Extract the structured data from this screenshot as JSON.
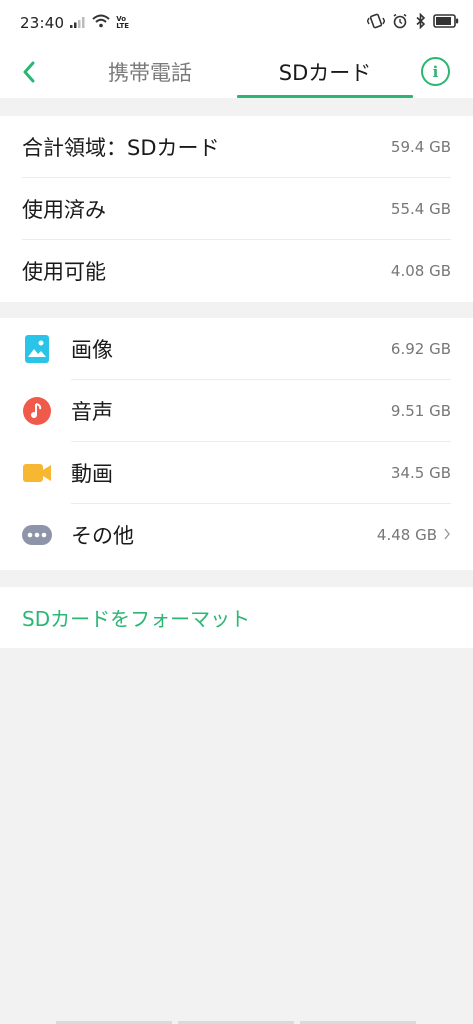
{
  "status_bar": {
    "time": "23:40",
    "volte_top": "Vo",
    "volte_bottom": "LTE",
    "icons": [
      "signal-icon",
      "wifi-icon",
      "volte-icon",
      "vibrate-icon",
      "alarm-icon",
      "bluetooth-icon",
      "battery-icon"
    ]
  },
  "header": {
    "tabs": [
      {
        "label": "携帯電話",
        "active": false
      },
      {
        "label": "SDカード",
        "active": true
      }
    ],
    "info_label": "i",
    "accent_color": "#2bb673"
  },
  "summary": {
    "rows": [
      {
        "label": "合計領域：SDカード",
        "value": "59.4 GB"
      },
      {
        "label": "使用済み",
        "value": "55.4 GB"
      },
      {
        "label": "使用可能",
        "value": "4.08 GB"
      }
    ]
  },
  "categories": {
    "rows": [
      {
        "label": "画像",
        "value": "6.92 GB",
        "icon": "image-icon",
        "color": "#29c4e8"
      },
      {
        "label": "音声",
        "value": "9.51 GB",
        "icon": "music-icon",
        "color": "#f05a4a"
      },
      {
        "label": "動画",
        "value": "34.5 GB",
        "icon": "video-icon",
        "color": "#f7b733"
      },
      {
        "label": "その他",
        "value": "4.48 GB",
        "icon": "more-icon",
        "color": "#8f95a8"
      }
    ]
  },
  "format": {
    "label": "SDカードをフォーマット"
  }
}
